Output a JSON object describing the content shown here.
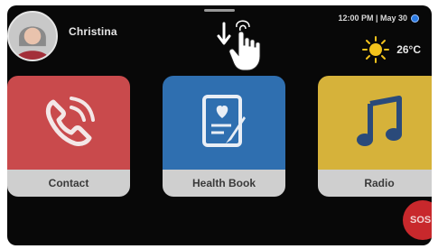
{
  "user": {
    "name": "Christina"
  },
  "status_bar": {
    "time_date": "12:00 PM | May 30"
  },
  "weather": {
    "temperature": "26°C",
    "icon": "sun-icon"
  },
  "tiles": [
    {
      "label": "Contact",
      "icon": "phone-icon",
      "color": "#c94a4c"
    },
    {
      "label": "Health Book",
      "icon": "heart-document-icon",
      "color": "#2f6fb0"
    },
    {
      "label": "Radio",
      "icon": "music-note-icon",
      "color": "#d6b23a"
    }
  ],
  "sos": {
    "label": "SOS",
    "color": "#c8282c"
  },
  "gesture_hint": {
    "icon": "swipe-down-hand-icon"
  }
}
